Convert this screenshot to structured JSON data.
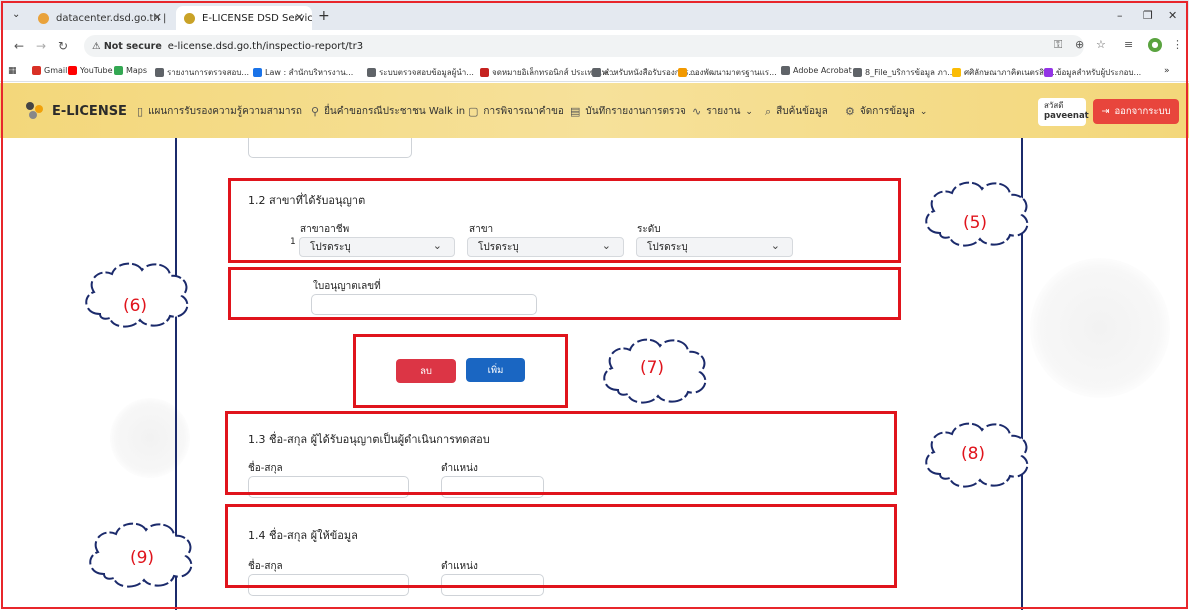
{
  "browser": {
    "tabs": [
      {
        "title": "datacenter.dsd.go.th |",
        "active": false
      },
      {
        "title": "E-LICENSE DSD Service - ระบบก",
        "active": true
      }
    ],
    "not_secure_label": "Not secure",
    "url": "e-license.dsd.go.th/inspectio-report/tr3",
    "bookmarks": [
      {
        "label": "Gmail",
        "color": "#d93025"
      },
      {
        "label": "YouTube",
        "color": "#ff0000"
      },
      {
        "label": "Maps",
        "color": "#34a853"
      },
      {
        "label": "รายงานการตรวจสอบ...",
        "color": "#5f6368"
      },
      {
        "label": "Law : สำนักบริหารงาน...",
        "color": "#1a73e8"
      },
      {
        "label": "ระบบตรวจสอบข้อมูลผู้นำ...",
        "color": "#5f6368"
      },
      {
        "label": "จดหมายอิเล็กทรอนิกส์ ประเทศไท...",
        "color": "#c5221f"
      },
      {
        "label": "สำหรับหนังสือรับรองการ...",
        "color": "#5f6368"
      },
      {
        "label": "กองพัฒนามาตรฐานแร...",
        "color": "#f29900"
      },
      {
        "label": "Adobe Acrobat",
        "color": "#5f6368"
      },
      {
        "label": "8_File_บริการข้อมูล ภา...",
        "color": "#5f6368"
      },
      {
        "label": "ศศิลักษณาภาคิตเนตรสิน...",
        "color": "#fbbc04"
      },
      {
        "label": "ข้อมูลสำหรับผู้ประกอบ...",
        "color": "#9334e6"
      }
    ]
  },
  "app": {
    "logo_text": "E-LICENSE",
    "nav": [
      {
        "label": "แผนการรับรองความรู้ความสามารถ",
        "icon": "book-icon"
      },
      {
        "label": "ยื่นคำขอกรณีประชาชน Walk in",
        "icon": "user-plus-icon"
      },
      {
        "label": "การพิจารณาคำขอ",
        "icon": "clipboard-icon"
      },
      {
        "label": "บันทึกรายงานการตรวจ",
        "icon": "document-icon"
      },
      {
        "label": "รายงาน",
        "icon": "activity-icon"
      },
      {
        "label": "สืบค้นข้อมูล",
        "icon": "search-icon"
      },
      {
        "label": "จัดการข้อมูล",
        "icon": "gear-icon"
      }
    ],
    "greeting": "สวัสดี",
    "username": "paveenat",
    "logout_label": "ออกจากระบบ"
  },
  "form": {
    "section_1_2": {
      "title": "1.2 สาขาที่ได้รับอนุญาต",
      "row_number": "1",
      "col_occupation": "สาขาอาชีพ",
      "col_branch": "สาขา",
      "col_level": "ระดับ",
      "select_placeholder": "โปรดระบุ"
    },
    "license_no_label": "ใบอนุญาตเลขที่",
    "delete_label": "ลบ",
    "add_label": "เพิ่ม",
    "section_1_3": {
      "title": "1.3 ชื่อ-สกุล ผู้ได้รับอนุญาตเป็นผู้ดำเนินการทดสอบ",
      "name_label": "ชื่อ-สกุล",
      "position_label": "ตำแหน่ง"
    },
    "section_1_4": {
      "title": "1.4 ชื่อ-สกุล ผู้ให้ข้อมูล",
      "name_label": "ชื่อ-สกุล",
      "position_label": "ตำแหน่ง"
    }
  },
  "annotations": [
    "(5)",
    "(6)",
    "(7)",
    "(8)",
    "(9)"
  ],
  "colors": {
    "annotation_red": "#e0141c",
    "header_gold": "#f3d77a",
    "logout_red": "#e8453c",
    "delete_red": "#dc3545",
    "add_blue": "#1a66c2",
    "frame_navy": "#1b2a6b"
  }
}
